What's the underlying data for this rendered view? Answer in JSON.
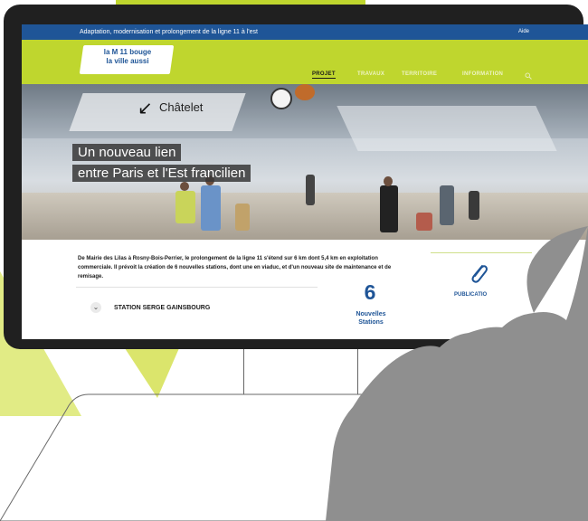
{
  "topbar": {
    "title": "Adaptation, modernisation et prolongement de la ligne 11 à l'est",
    "help": "Aide"
  },
  "logo": {
    "line1": "la M 11 bouge",
    "line2": "la ville aussi"
  },
  "nav": {
    "items": [
      {
        "label": "PROJET",
        "active": true
      },
      {
        "label": "TRAVAUX",
        "active": false
      },
      {
        "label": "TERRITOIRE",
        "active": false
      },
      {
        "label": "INFORMATION",
        "active": false
      }
    ],
    "search_icon": "search-icon"
  },
  "hero": {
    "sign": "Châtelet",
    "sign_arrow": "↙",
    "line1": "Un nouveau lien",
    "line2": "entre Paris et l'Est francilien",
    "metro_badge": "M",
    "line_badge": "11"
  },
  "content": {
    "intro": "De Mairie des Lilas à Rosny-Bois-Perrier, le prolongement de la ligne 11 s'étend sur 6 km dont 5,4 km en exploitation commerciale. Il prévoit la création de 6 nouvelles stations, dont une en viaduc, et d'un nouveau site de maintenance et de remisage.",
    "station": "STATION SERGE GAINSBOURG",
    "stat_number": "6",
    "stat_label_line1": "Nouvelles",
    "stat_label_line2": "Stations",
    "publications": "PUBLICATIO"
  },
  "colors": {
    "brand_blue": "#1f5597",
    "brand_green": "#bfd62e"
  }
}
